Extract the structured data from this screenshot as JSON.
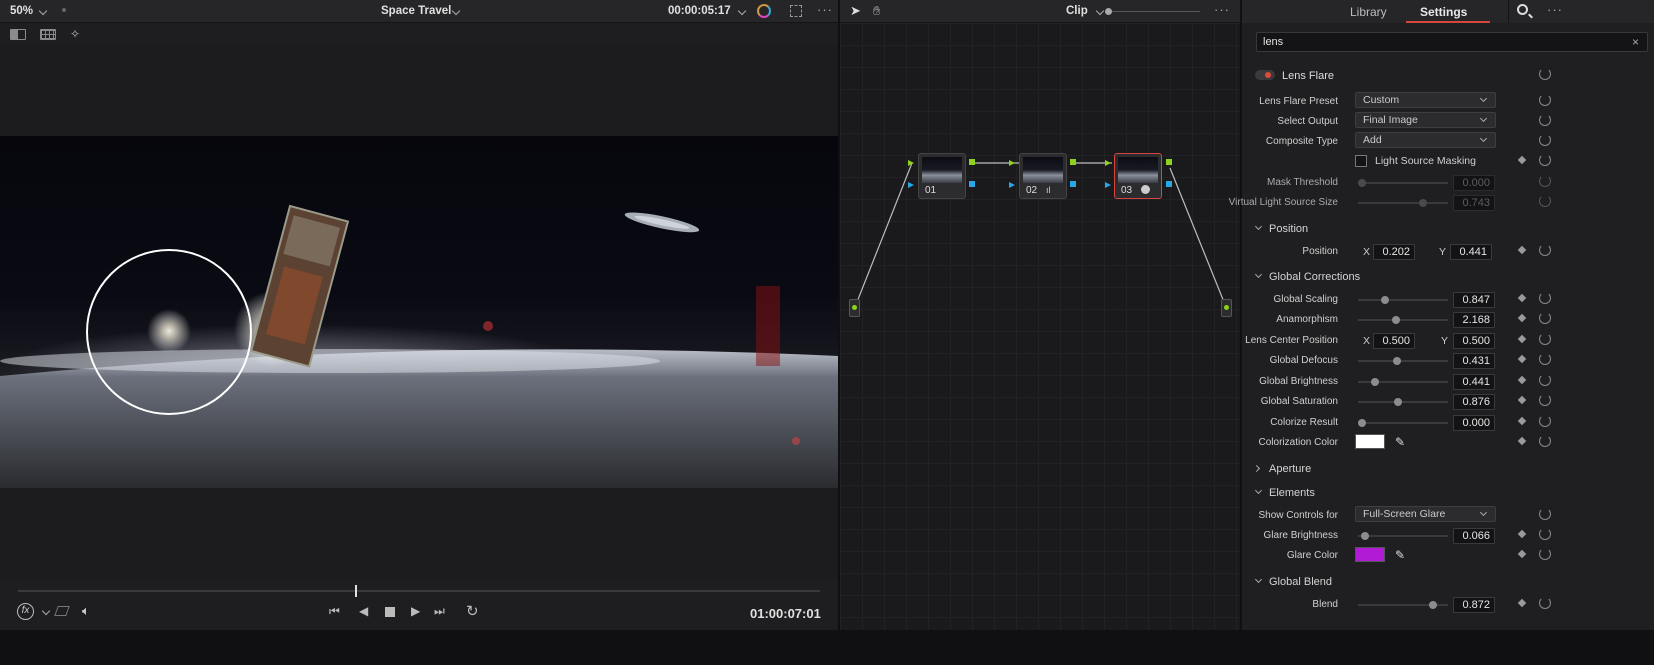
{
  "viewer": {
    "zoom": "50%",
    "title": "Space Travel",
    "timecode_top": "00:00:05:17",
    "timecode_bottom": "01:00:07:01",
    "playhead_fraction": 0.42
  },
  "nodes": {
    "title": "Clip",
    "items": [
      {
        "label": "01"
      },
      {
        "label": "02"
      },
      {
        "label": "03"
      }
    ]
  },
  "inspector": {
    "tabs": {
      "library": "Library",
      "settings": "Settings"
    },
    "search_value": "lens",
    "search_clear": "×",
    "effect_name": "Lens Flare",
    "rows": {
      "preset": {
        "label": "Lens Flare Preset",
        "value": "Custom"
      },
      "output": {
        "label": "Select Output",
        "value": "Final Image"
      },
      "composite": {
        "label": "Composite Type",
        "value": "Add"
      },
      "masking": {
        "label": "Light Source Masking",
        "checked": false
      },
      "mask_threshold": {
        "label": "Mask Threshold",
        "value": "0.000",
        "level": 0.0
      },
      "virtual_size": {
        "label": "Virtual Light Source Size",
        "value": "0.743",
        "level": 0.743
      }
    },
    "position": {
      "section": "Position",
      "label": "Position",
      "x_label": "X",
      "x": "0.202",
      "y_label": "Y",
      "y": "0.441"
    },
    "global_corrections": {
      "section": "Global Corrections",
      "scaling": {
        "label": "Global Scaling",
        "value": "0.847",
        "level": 0.28
      },
      "anamorphism": {
        "label": "Anamorphism",
        "value": "2.168",
        "level": 0.42
      },
      "center": {
        "label": "Lens Center Position",
        "x_label": "X",
        "x": "0.500",
        "y_label": "Y",
        "y": "0.500"
      },
      "defocus": {
        "label": "Global Defocus",
        "value": "0.431",
        "level": 0.43
      },
      "brightness": {
        "label": "Global Brightness",
        "value": "0.441",
        "level": 0.16
      },
      "saturation": {
        "label": "Global Saturation",
        "value": "0.876",
        "level": 0.44
      },
      "colorize": {
        "label": "Colorize Result",
        "value": "0.000",
        "level": 0.0
      },
      "colorization_color": {
        "label": "Colorization Color",
        "color": "#ffffff"
      }
    },
    "aperture": {
      "section": "Aperture"
    },
    "elements": {
      "section": "Elements",
      "show_controls": {
        "label": "Show Controls for",
        "value": "Full-Screen Glare"
      },
      "glare_brightness": {
        "label": "Glare Brightness",
        "value": "0.066",
        "level": 0.04
      },
      "glare_color": {
        "label": "Glare Color",
        "color": "#b21bd6"
      }
    },
    "global_blend": {
      "section": "Global Blend",
      "blend": {
        "label": "Blend",
        "value": "0.872",
        "level": 0.87
      }
    }
  },
  "colors": {
    "accent": "#d6453e",
    "port_green": "#8fd11c",
    "port_blue": "#2aa6e8"
  }
}
